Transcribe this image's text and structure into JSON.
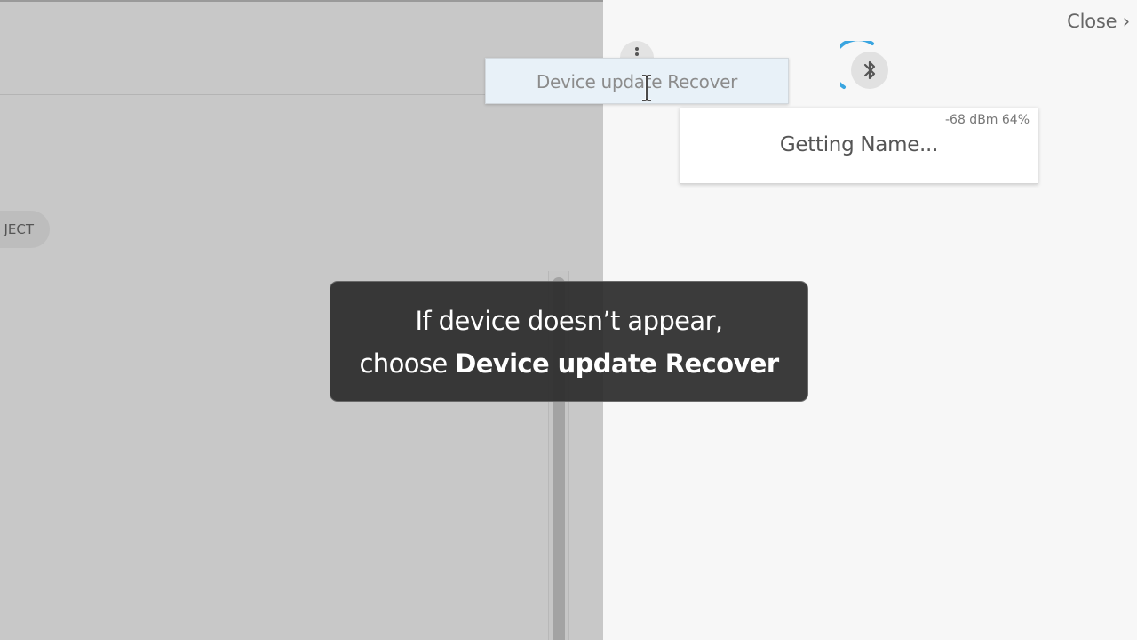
{
  "left_panel": {
    "pill_label": "JECT"
  },
  "right_panel": {
    "close_label": "Close ›",
    "menu": {
      "item_label": "Device update Recover"
    },
    "device": {
      "signal": "-68 dBm 64%",
      "name": "Getting Name..."
    }
  },
  "caption": {
    "line1": "If device doesn’t appear,",
    "line2_prefix": "choose ",
    "line2_bold": "Device update Recover"
  },
  "icons": {
    "menu": "kebab-icon",
    "bluetooth": "bluetooth-icon",
    "cursor": "text-cursor-icon"
  },
  "colors": {
    "spinner_arc": "#3aa5e0",
    "caption_bg": "#2c2c2c",
    "dropdown_highlight": "#e8f1f8"
  }
}
